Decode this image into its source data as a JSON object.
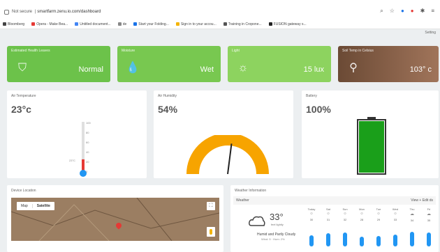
{
  "browser": {
    "security": "Not secure",
    "url": "smartfarm.zenu.io.com/dashboard",
    "bookmarks": [
      "Bloomberg",
      "Opera - Make Bea...",
      "Untitled document...",
      "de",
      "Start your Folding...",
      "Sign in to your accou...",
      "Training in Cropone...",
      "FUSION gateway s..."
    ]
  },
  "setting_label": "Setting",
  "top_cards": [
    {
      "title": "Estimated Health Leaves",
      "value": "Normal",
      "icon": "leaf-shield-icon",
      "color": "#6cc24a"
    },
    {
      "title": "Moisture",
      "value": "Wet",
      "icon": "water-drop-icon",
      "color": "#78c850"
    },
    {
      "title": "Light",
      "value": "15 lux",
      "icon": "sun-icon",
      "color": "#8dd35f"
    },
    {
      "title": "Soil Temp in Celsius",
      "value": "103° c",
      "icon": "thermometer-icon",
      "color": "#8b6548"
    }
  ],
  "air_temperature": {
    "label": "Air Temperature",
    "value": "23°c",
    "reading": 23,
    "scale_max": 100,
    "ticks": [
      "100",
      "80",
      "60",
      "40",
      "20",
      "0"
    ],
    "marker": "23°C"
  },
  "air_humidity": {
    "label": "Air Humidity",
    "value": "54%",
    "reading": 54
  },
  "battery": {
    "label": "Battery",
    "value": "100%",
    "level": 100
  },
  "device_location": {
    "label": "Device Location",
    "map_tab": "Map",
    "satellite_tab": "Satellite"
  },
  "weather": {
    "label": "Weather Information",
    "city": "Weather",
    "more": "View + Edit ds",
    "temp": "33°",
    "temp_sub": "feel lightly",
    "condition": "Humid and Partly Cloudy",
    "details": "Wind: 5 · Hum: 2%",
    "days": [
      {
        "name": "Today",
        "icon": "☼",
        "hi": "30",
        "level": 0.55
      },
      {
        "name": "Sat",
        "icon": "☼",
        "hi": "31",
        "level": 0.7
      },
      {
        "name": "Sun",
        "icon": "☼",
        "hi": "32",
        "level": 0.75
      },
      {
        "name": "Mon",
        "icon": "☼",
        "hi": "28",
        "level": 0.45
      },
      {
        "name": "Tue",
        "icon": "☼",
        "hi": "29",
        "level": 0.5
      },
      {
        "name": "Wed",
        "icon": "☼",
        "hi": "33",
        "level": 0.6
      },
      {
        "name": "Thu",
        "icon": "☁",
        "hi": "34",
        "level": 0.85
      },
      {
        "name": "Fri",
        "icon": "☁",
        "hi": "35",
        "level": 0.8
      }
    ]
  }
}
